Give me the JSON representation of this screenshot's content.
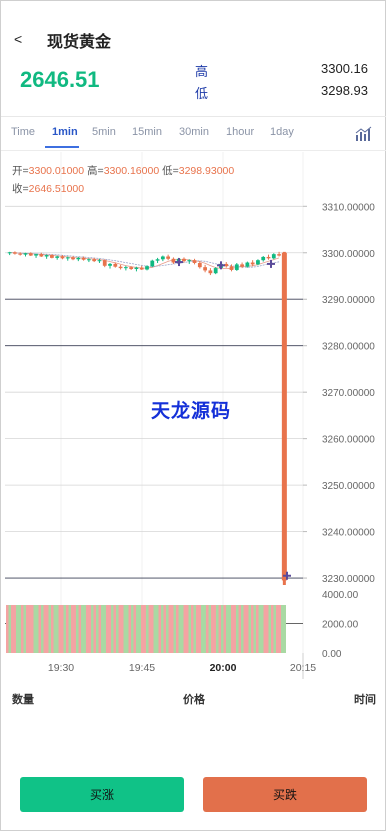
{
  "header": {
    "back_label": "<",
    "title": "现货黄金",
    "price": "2646.51",
    "high_label": "高",
    "high_value": "3300.16",
    "low_label": "低",
    "low_value": "3298.93"
  },
  "tabs": [
    {
      "label": "Time"
    },
    {
      "label": "1min",
      "active": true
    },
    {
      "label": "5min"
    },
    {
      "label": "15min"
    },
    {
      "label": "30min"
    },
    {
      "label": "1hour"
    },
    {
      "label": "1day"
    }
  ],
  "indicator_icon": "bar-chart-icon",
  "ohlc": {
    "open_label": "开=",
    "open_value": "3300.01000",
    "high_label": "高=",
    "high_value": "3300.16000",
    "low_label": "低=",
    "low_value": "3298.93000",
    "close_label": "收=",
    "close_value": "2646.51000"
  },
  "watermark": "天龙源码",
  "chart_data": {
    "type": "candlestick",
    "price_axis": {
      "ticks": [
        "3310.00000",
        "3300.00000",
        "3290.00000",
        "3280.00000",
        "3270.00000",
        "3260.00000",
        "3250.00000",
        "3240.00000",
        "3230.00000"
      ],
      "range": [
        3227,
        3312
      ]
    },
    "volume_axis": {
      "ticks": [
        "4000.00",
        "2000.00",
        "0.00"
      ],
      "range": [
        0,
        4000
      ]
    },
    "time_axis": {
      "ticks": [
        "19:30",
        "19:45",
        "20:00",
        "20:15"
      ],
      "bold": "20:00"
    },
    "candles": [
      [
        3300.0,
        3300.2,
        3299.5,
        3300.1
      ],
      [
        3300.1,
        3300.3,
        3299.6,
        3299.8
      ],
      [
        3299.8,
        3300.1,
        3299.4,
        3299.6
      ],
      [
        3299.6,
        3300.0,
        3299.2,
        3299.9
      ],
      [
        3299.9,
        3300.1,
        3299.3,
        3299.4
      ],
      [
        3299.4,
        3299.8,
        3298.9,
        3299.7
      ],
      [
        3299.7,
        3300.0,
        3299.1,
        3299.2
      ],
      [
        3299.2,
        3299.6,
        3298.7,
        3299.5
      ],
      [
        3299.5,
        3299.7,
        3298.8,
        3298.9
      ],
      [
        3298.9,
        3299.4,
        3298.5,
        3299.2
      ],
      [
        3299.2,
        3299.5,
        3298.6,
        3298.8
      ],
      [
        3298.8,
        3299.2,
        3298.3,
        3299.0
      ],
      [
        3299.0,
        3299.3,
        3298.4,
        3298.6
      ],
      [
        3298.6,
        3299.1,
        3298.2,
        3298.9
      ],
      [
        3298.9,
        3299.2,
        3298.3,
        3298.5
      ],
      [
        3298.5,
        3298.8,
        3298.0,
        3298.6
      ],
      [
        3298.6,
        3298.9,
        3298.0,
        3298.2
      ],
      [
        3298.2,
        3298.7,
        3297.8,
        3298.4
      ],
      [
        3298.4,
        3298.6,
        3296.9,
        3297.2
      ],
      [
        3297.2,
        3297.8,
        3296.6,
        3297.6
      ],
      [
        3297.6,
        3297.9,
        3296.8,
        3297.0
      ],
      [
        3297.0,
        3297.4,
        3296.4,
        3296.7
      ],
      [
        3296.7,
        3297.2,
        3296.2,
        3296.9
      ],
      [
        3296.9,
        3297.1,
        3296.3,
        3296.5
      ],
      [
        3296.5,
        3297.0,
        3296.0,
        3296.8
      ],
      [
        3296.8,
        3297.2,
        3296.3,
        3296.4
      ],
      [
        3296.4,
        3297.3,
        3296.2,
        3297.1
      ],
      [
        3297.1,
        3298.5,
        3296.9,
        3298.3
      ],
      [
        3298.3,
        3298.9,
        3297.8,
        3298.6
      ],
      [
        3298.6,
        3299.4,
        3298.2,
        3299.2
      ],
      [
        3299.2,
        3299.6,
        3298.4,
        3298.7
      ],
      [
        3298.7,
        3299.0,
        3297.6,
        3297.9
      ],
      [
        3297.9,
        3298.9,
        3297.7,
        3298.7
      ],
      [
        3298.7,
        3299.0,
        3297.9,
        3298.2
      ],
      [
        3298.2,
        3298.6,
        3297.6,
        3298.4
      ],
      [
        3298.4,
        3298.7,
        3297.5,
        3297.8
      ],
      [
        3297.8,
        3298.2,
        3296.6,
        3296.9
      ],
      [
        3296.9,
        3297.4,
        3295.8,
        3296.2
      ],
      [
        3296.2,
        3296.7,
        3295.2,
        3295.6
      ],
      [
        3295.6,
        3296.9,
        3295.4,
        3296.7
      ],
      [
        3296.7,
        3297.8,
        3296.5,
        3297.6
      ],
      [
        3297.6,
        3298.0,
        3296.8,
        3297.1
      ],
      [
        3297.1,
        3297.5,
        3296.0,
        3296.3
      ],
      [
        3296.3,
        3297.8,
        3296.1,
        3297.5
      ],
      [
        3297.5,
        3297.9,
        3296.7,
        3297.0
      ],
      [
        3297.0,
        3298.1,
        3296.8,
        3297.9
      ],
      [
        3297.9,
        3298.4,
        3297.1,
        3297.5
      ],
      [
        3297.5,
        3298.6,
        3297.3,
        3298.4
      ],
      [
        3298.4,
        3299.3,
        3298.1,
        3299.1
      ],
      [
        3299.1,
        3299.6,
        3298.5,
        3298.8
      ],
      [
        3298.8,
        3299.9,
        3298.6,
        3299.7
      ],
      [
        3299.7,
        3300.2,
        3299.2,
        3299.4
      ],
      [
        3300.0,
        3300.2,
        3228.5,
        3229.5
      ]
    ]
  },
  "trade_table": {
    "col_qty": "数量",
    "col_price": "价格",
    "col_time": "时间"
  },
  "buttons": {
    "buy_up": "买涨",
    "buy_down": "买跌"
  },
  "colors": {
    "up": "#10b981",
    "down": "#e8734c",
    "accent": "#2a57c7"
  }
}
